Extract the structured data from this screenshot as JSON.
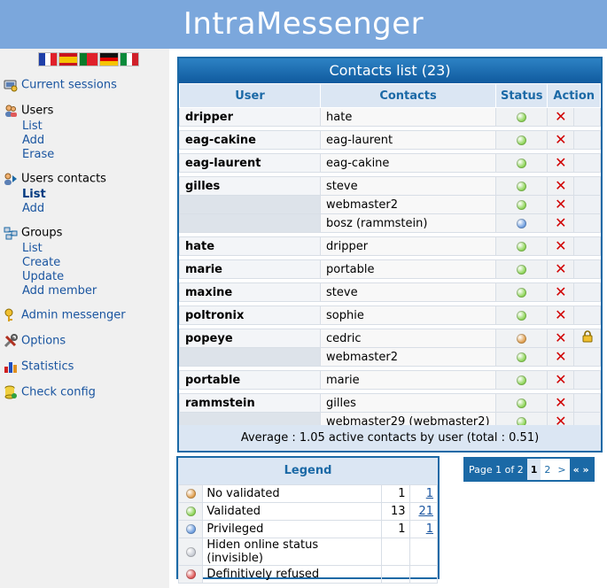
{
  "app": {
    "title": "IntraMessenger"
  },
  "flags": [
    "french-flag-icon",
    "spanish-flag-icon",
    "portuguese-flag-icon",
    "german-flag-icon",
    "italian-flag-icon"
  ],
  "sidebar": {
    "current_sessions": "Current sessions",
    "users": {
      "title": "Users",
      "items": [
        "List",
        "Add",
        "Erase"
      ]
    },
    "users_contacts": {
      "title": "Users contacts",
      "items": [
        "List",
        "Add"
      ]
    },
    "groups": {
      "title": "Groups",
      "items": [
        "List",
        "Create",
        "Update",
        "Add member"
      ]
    },
    "admin_messenger": "Admin messenger",
    "options": "Options",
    "statistics": "Statistics",
    "check_config": "Check config"
  },
  "contacts": {
    "title": "Contacts list (23)",
    "headers": {
      "user": "User",
      "contacts": "Contacts",
      "status": "Status",
      "action": "Action"
    },
    "groups": [
      {
        "user": "dripper",
        "rows": [
          {
            "contact": "hate",
            "status": "validated"
          }
        ]
      },
      {
        "user": "eag-cakine",
        "rows": [
          {
            "contact": "eag-laurent",
            "status": "validated"
          }
        ]
      },
      {
        "user": "eag-laurent",
        "rows": [
          {
            "contact": "eag-cakine",
            "status": "validated"
          }
        ]
      },
      {
        "user": "gilles",
        "rows": [
          {
            "contact": "steve",
            "status": "validated"
          },
          {
            "contact": "webmaster2",
            "status": "validated"
          },
          {
            "contact": "bosz (rammstein)",
            "status": "privileged"
          }
        ]
      },
      {
        "user": "hate",
        "rows": [
          {
            "contact": "dripper",
            "status": "validated"
          }
        ]
      },
      {
        "user": "marie",
        "rows": [
          {
            "contact": "portable",
            "status": "validated"
          }
        ]
      },
      {
        "user": "maxine",
        "rows": [
          {
            "contact": "steve",
            "status": "validated"
          }
        ]
      },
      {
        "user": "poltronix",
        "rows": [
          {
            "contact": "sophie",
            "status": "validated"
          }
        ]
      },
      {
        "user": "popeye",
        "rows": [
          {
            "contact": "cedric",
            "status": "not_validated",
            "locked": true
          },
          {
            "contact": "webmaster2",
            "status": "validated"
          }
        ]
      },
      {
        "user": "portable",
        "rows": [
          {
            "contact": "marie",
            "status": "validated"
          }
        ]
      },
      {
        "user": "rammstein",
        "rows": [
          {
            "contact": "gilles",
            "status": "validated"
          },
          {
            "contact": "webmaster29 (webmaster2)",
            "status": "validated"
          }
        ]
      }
    ],
    "footer": "Average : 1.05 active contacts by user (total : 0.51)"
  },
  "legend": {
    "title": "Legend",
    "rows": [
      {
        "label": "No validated",
        "status": "not_validated",
        "count": "1",
        "link": "1"
      },
      {
        "label": "Validated",
        "status": "validated",
        "count": "13",
        "link": "21"
      },
      {
        "label": "Privileged",
        "status": "privileged",
        "count": "1",
        "link": "1"
      },
      {
        "label": "Hiden online status (invisible)",
        "status": "hidden",
        "count": "",
        "link": ""
      },
      {
        "label": "Definitively refused",
        "status": "refused",
        "count": "",
        "link": ""
      }
    ]
  },
  "pager": {
    "label": "Page 1 of 2",
    "pages": [
      "1",
      "2"
    ],
    "next": ">",
    "all": "« »"
  },
  "colors": {
    "validated": "#8fd65a",
    "privileged": "#6f9fe0",
    "not_validated": "#e0a050",
    "hidden": "#c8ccd4",
    "refused": "#e05a5a",
    "header_bg": "#7ba7dc",
    "accent": "#1b69a6"
  }
}
